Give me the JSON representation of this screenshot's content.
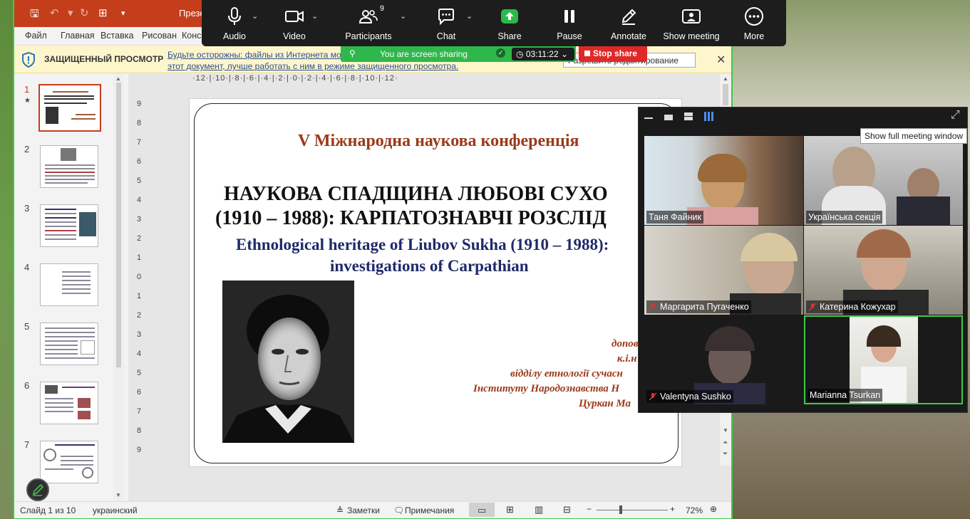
{
  "powerpoint": {
    "window_title": "Презе",
    "ribbon_tabs": [
      "Файл",
      "Главная",
      "Вставка",
      "Рисован",
      "Конс"
    ],
    "protected_view": {
      "title": "ЗАЩИЩЕННЫЙ ПРОСМОТР",
      "message": "Будьте осторожны: файлы из Интернета мог",
      "message2": "этот документ, лучше работать с ним в режиме защищенного просмотра.",
      "enable_button": "Разрешить редактирование",
      "close": "✕"
    },
    "thumbnails": [
      "1",
      "2",
      "3",
      "4",
      "5",
      "6",
      "7"
    ],
    "ruler_h": "·12·|·10·|·8·|·6·|·4·|·2·|·0·|·2·|·4·|·6·|·8·|·10·|·12·",
    "ruler_v": [
      "9",
      "8",
      "7",
      "6",
      "5",
      "4",
      "3",
      "2",
      "1",
      "0",
      "1",
      "2",
      "3",
      "4",
      "5",
      "6",
      "7",
      "8",
      "9"
    ],
    "slide": {
      "conf": "V Міжнародна наукова конференція",
      "title1": "НАУКОВА СПАДЩИНА ЛЮБОВІ СУХО",
      "title2": "(1910 – 1988): КАРПАТОЗНАВЧІ РОЗСЛІД",
      "en1": "Ethnological heritage of Liubov Sukha (1910 – 1988):",
      "en2": "investigations of Carpathian",
      "info1": "допов",
      "info2": "к.і.н",
      "info3": "відділу етнології сучасн",
      "info4": "Інституту Народознавства Н",
      "info5": "Цуркан Ма"
    },
    "status": {
      "slide": "Слайд 1 из 10",
      "lang": "украинский",
      "notes": "Заметки",
      "comments": "Примечания",
      "zoom": "72%"
    }
  },
  "zoom": {
    "toolbar": [
      {
        "label": "Audio",
        "icon": "microphone-icon"
      },
      {
        "label": "Video",
        "icon": "video-camera-icon"
      },
      {
        "label": "Participants",
        "icon": "participants-icon",
        "count": "9"
      },
      {
        "label": "Chat",
        "icon": "chat-icon"
      },
      {
        "label": "Share",
        "icon": "share-icon"
      },
      {
        "label": "Pause",
        "icon": "pause-icon"
      },
      {
        "label": "Annotate",
        "icon": "annotate-icon"
      },
      {
        "label": "Show meeting",
        "icon": "show-meeting-icon"
      },
      {
        "label": "More",
        "icon": "more-icon"
      }
    ],
    "sharing_banner": "You are screen sharing",
    "timer": "03:11:22",
    "stop_share": "Stop share",
    "tooltip": "Show full meeting window",
    "participants": [
      {
        "name": "Таня Файник",
        "muted": false
      },
      {
        "name": "Українська секція",
        "muted": false
      },
      {
        "name": "Маргарита Пугаченко",
        "muted": true
      },
      {
        "name": "Катерина Кожухар",
        "muted": true
      },
      {
        "name": "Valentyna Sushko",
        "muted": true
      },
      {
        "name": "Marianna Tsurkan",
        "muted": false
      }
    ]
  }
}
